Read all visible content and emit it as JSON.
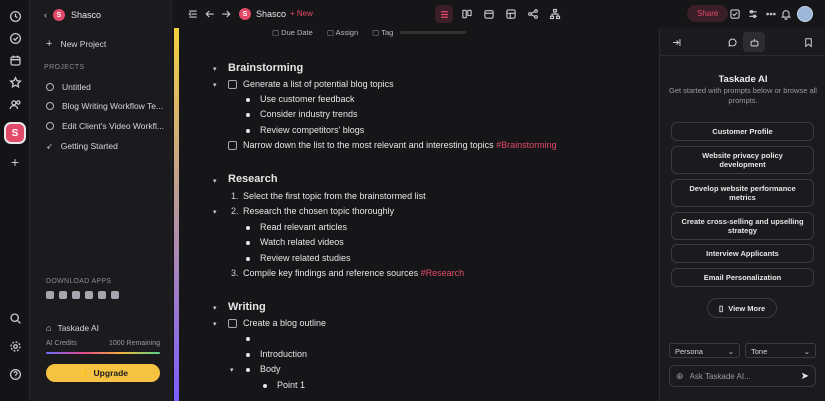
{
  "rail": {
    "icons": [
      "clock-icon",
      "check-circle-icon",
      "calendar-icon",
      "star-icon",
      "people-icon"
    ],
    "workspace_letter": "S",
    "add": "+",
    "bottom_icons": [
      "search-icon",
      "settings-icon",
      "help-icon"
    ]
  },
  "sidebar": {
    "workspace_name": "Shasco",
    "workspace_letter": "S",
    "new_project": "New Project",
    "projects_heading": "PROJECTS",
    "projects": [
      "Untitled",
      "Blog Writing Workflow Te...",
      "Edit Client's Video Workfl...",
      "Getting Started"
    ],
    "download_heading": "DOWNLOAD APPS",
    "ai_label": "Taskade AI",
    "ai_credits_label": "AI Credits",
    "ai_credits_remaining": "1000 Remaining",
    "upgrade_label": "Upgrade"
  },
  "header": {
    "title": "Shasco",
    "title_letter": "S",
    "new_label": "New",
    "share_label": "Share"
  },
  "editor": {
    "toolbar": [
      "Due Date",
      "Assign",
      "Tag"
    ],
    "sections": [
      {
        "title": "Brainstorming",
        "items": [
          {
            "text": "Generate a list of potential blog topics",
            "tag": ""
          },
          {
            "text": "Use customer feedback"
          },
          {
            "text": "Consider industry trends"
          },
          {
            "text": "Review competitors' blogs"
          },
          {
            "text": "Narrow down the list to the most relevant and interesting topics",
            "tag": "#Brainstorming"
          }
        ]
      },
      {
        "title": "Research",
        "items": [
          {
            "num": "1.",
            "text": "Select the first topic from the brainstormed list"
          },
          {
            "num": "2.",
            "text": "Research the chosen topic thoroughly"
          },
          {
            "text": "Read relevant articles"
          },
          {
            "text": "Watch related videos"
          },
          {
            "text": "Review related studies"
          },
          {
            "num": "3.",
            "text": "Compile key findings and reference sources",
            "tag": "#Research"
          }
        ]
      },
      {
        "title": "Writing",
        "items": [
          {
            "text": "Create a blog outline"
          },
          {
            "text": ""
          },
          {
            "text": "Introduction"
          },
          {
            "text": "Body"
          },
          {
            "text": "Point 1"
          }
        ]
      }
    ]
  },
  "panel": {
    "title": "Taskade AI",
    "subtitle": "Get started with prompts below or browse all prompts.",
    "prompts": [
      "Customer Profile",
      "Website privacy policy development",
      "Develop website performance metrics",
      "Create cross-selling and upselling strategy",
      "Interview Applicants",
      "Email Personalization"
    ],
    "view_more": "View More",
    "persona": "Persona",
    "tone": "Tone",
    "ask_placeholder": "Ask Taskade AI..."
  },
  "colors": {
    "accent": "#e24a6a",
    "upgrade": "#f5c242",
    "background": "#161618"
  }
}
